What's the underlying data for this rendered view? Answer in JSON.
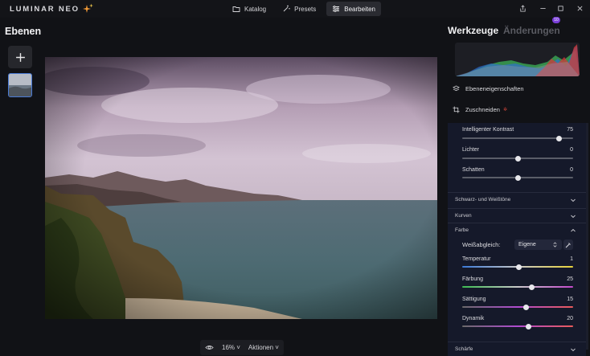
{
  "app": {
    "logo_text": "LUMINAR NEO"
  },
  "nav": {
    "tabs": [
      {
        "label": "Katalog",
        "icon": "folder-icon"
      },
      {
        "label": "Presets",
        "icon": "magic-wand-icon"
      },
      {
        "label": "Bearbeiten",
        "icon": "sliders-icon",
        "active": true
      }
    ]
  },
  "left": {
    "title": "Ebenen"
  },
  "canvas": {
    "zoom": "16%",
    "actions_label": "Aktionen"
  },
  "right": {
    "tabs": {
      "tools": "Werkzeuge",
      "changes": "Änderungen",
      "changes_badge": "10"
    },
    "layer_props": "Ebeneneigenschaften",
    "crop": "Zuschneiden",
    "sliders_top": [
      {
        "label": "Intelligenter Kontrast",
        "value": "75",
        "fraction": 0.87
      },
      {
        "label": "Lichter",
        "value": "0",
        "fraction": 0.5
      },
      {
        "label": "Schatten",
        "value": "0",
        "fraction": 0.5
      }
    ],
    "sections": [
      {
        "label": "Schwarz- und Weißtöne"
      },
      {
        "label": "Kurven"
      },
      {
        "label": "Farbe"
      },
      {
        "label": "Schärfe"
      }
    ],
    "farbe": {
      "wb_label": "Weißabgleich:",
      "wb_value": "Eigene",
      "sliders": [
        {
          "label": "Temperatur",
          "value": "1",
          "fraction": 0.51
        },
        {
          "label": "Färbung",
          "value": "25",
          "fraction": 0.625
        },
        {
          "label": "Sättigung",
          "value": "15",
          "fraction": 0.575
        },
        {
          "label": "Dynamik",
          "value": "20",
          "fraction": 0.6
        }
      ]
    }
  }
}
